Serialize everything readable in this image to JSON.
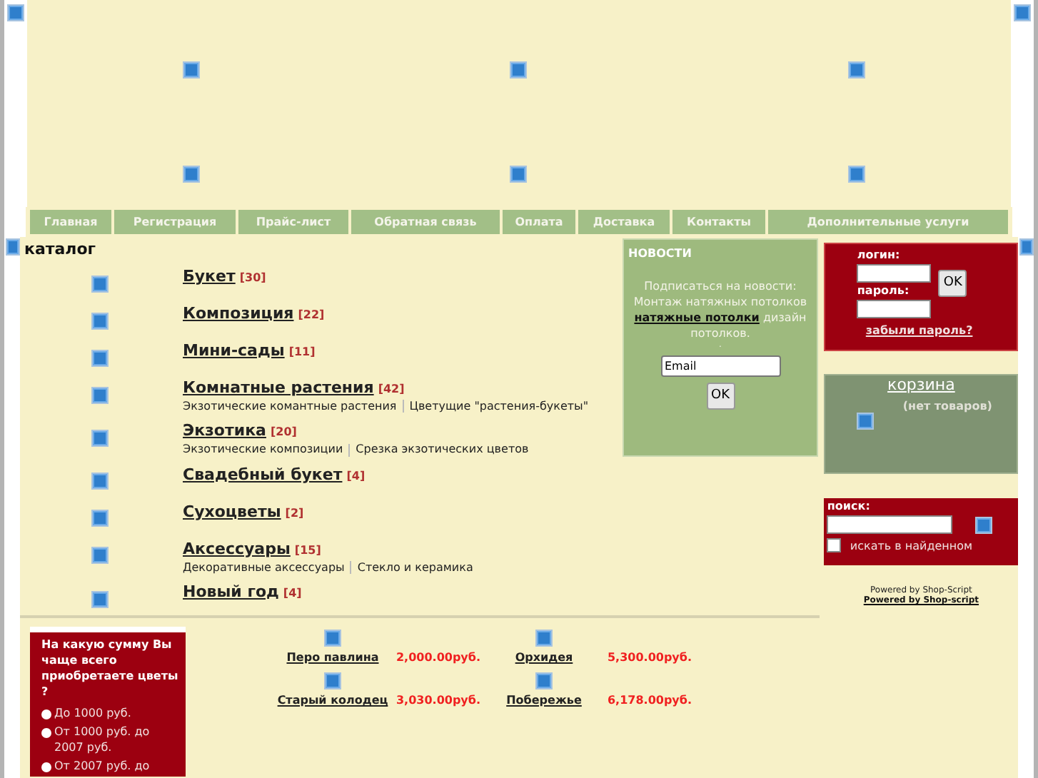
{
  "nav": [
    {
      "label": "Главная"
    },
    {
      "label": "Регистрация"
    },
    {
      "label": "Прайс-лист"
    },
    {
      "label": "Обратная связь"
    },
    {
      "label": "Оплата"
    },
    {
      "label": "Доставка"
    },
    {
      "label": "Контакты"
    },
    {
      "label": "Дополнительные услуги"
    }
  ],
  "catalog": {
    "title": "каталог",
    "categories": [
      {
        "name": "Букет",
        "count": "[30]"
      },
      {
        "name": "Композиция",
        "count": "[22]"
      },
      {
        "name": "Мини-сады",
        "count": "[11]"
      },
      {
        "name": "Комнатные растения",
        "count": "[42]",
        "subcategories": [
          "Экзотические комантные растения",
          "Цветущие \"растения-букеты\""
        ]
      },
      {
        "name": "Экзотика",
        "count": "[20]",
        "subcategories": [
          "Экзотические композиции",
          "Срезка экзотических цветов"
        ]
      },
      {
        "name": "Свадебный букет",
        "count": "[4]"
      },
      {
        "name": "Сухоцветы",
        "count": "[2]"
      },
      {
        "name": "Аксессуары",
        "count": "[15]",
        "subcategories": [
          "Декоративные аксессуары",
          "Стекло и керамика"
        ]
      },
      {
        "name": "Новый год",
        "count": "[4]"
      }
    ]
  },
  "news": {
    "title": "НОВОСТИ",
    "text_before": "Подписаться на новости: Монтаж натяжных потолков",
    "link": "натяжные потолки",
    "text_after": "дизайн потолков.",
    "dot": ".",
    "email_value": "Email",
    "button": "OK"
  },
  "login": {
    "login_label": "логин:",
    "password_label": "пароль:",
    "button": "OK",
    "forgot_link": "забыли пароль?"
  },
  "cart": {
    "title": "корзина",
    "empty_text": "(нет товаров)"
  },
  "search": {
    "label": "поиск:",
    "checkbox_label": "искать в найденном",
    "checked": false
  },
  "powered": {
    "text": "Powered by Shop-Script",
    "link": "Powered by Shop-script"
  },
  "poll": {
    "question": "На какую сумму Вы чаще всего приобретаете цветы ?",
    "options": [
      {
        "label": "До 1000 руб.",
        "selected": false
      },
      {
        "label": "От 1000 руб. до 2007 руб.",
        "selected": false
      },
      {
        "label": "От 2007 руб. до",
        "selected": false
      }
    ]
  },
  "products": [
    {
      "name": "Перо павлина",
      "price": "2,000.00руб."
    },
    {
      "name": "Орхидея",
      "price": "5,300.00руб."
    },
    {
      "name": "Старый колодец",
      "price": "3,030.00руб."
    },
    {
      "name": "Побережье",
      "price": "6,178.00руб."
    }
  ]
}
